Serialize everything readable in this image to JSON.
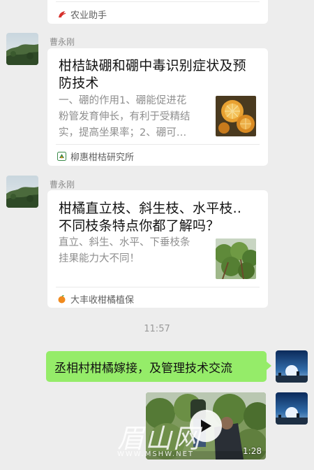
{
  "top_card": {
    "source": "农业助手",
    "source_icon": "farm-logo-icon"
  },
  "messages": [
    {
      "sender": "曹永刚",
      "title": "柑桔缺硼和硼中毒识别症状及预防技术",
      "title_lines": [
        "柑桔缺硼和硼中毒识别症状及预",
        "防技术"
      ],
      "desc_lines": [
        "一、硼的作用1、硼能促进花",
        "粉管发育伸长，有利于受精结",
        "实，提高坐果率；2、硼可…"
      ],
      "source": "柳惠柑桔研究所",
      "source_icon": "research-institute-logo-icon"
    },
    {
      "sender": "曹永刚",
      "title": "柑橘直立枝、斜生枝、水平枝..不同枝条特点你都了解吗？",
      "title_lines": [
        "柑橘直立枝、斜生枝、水平枝..",
        "不同枝条特点你都了解吗？"
      ],
      "desc_lines": [
        "直立、斜生、水平、下垂枝条",
        "挂果能力大不同！"
      ],
      "source": "大丰收柑橘植保",
      "source_icon": "orange-logo-icon"
    }
  ],
  "timestamp": "11:57",
  "my_message": {
    "text": "丞相村柑橘嫁接，及管理技术交流"
  },
  "video": {
    "duration": "1:28",
    "watermark_main": "眉山网",
    "watermark_url": "WWW.MSHW.NET"
  },
  "colors": {
    "background": "#ededed",
    "my_bubble": "#95ec69",
    "card": "#ffffff"
  }
}
